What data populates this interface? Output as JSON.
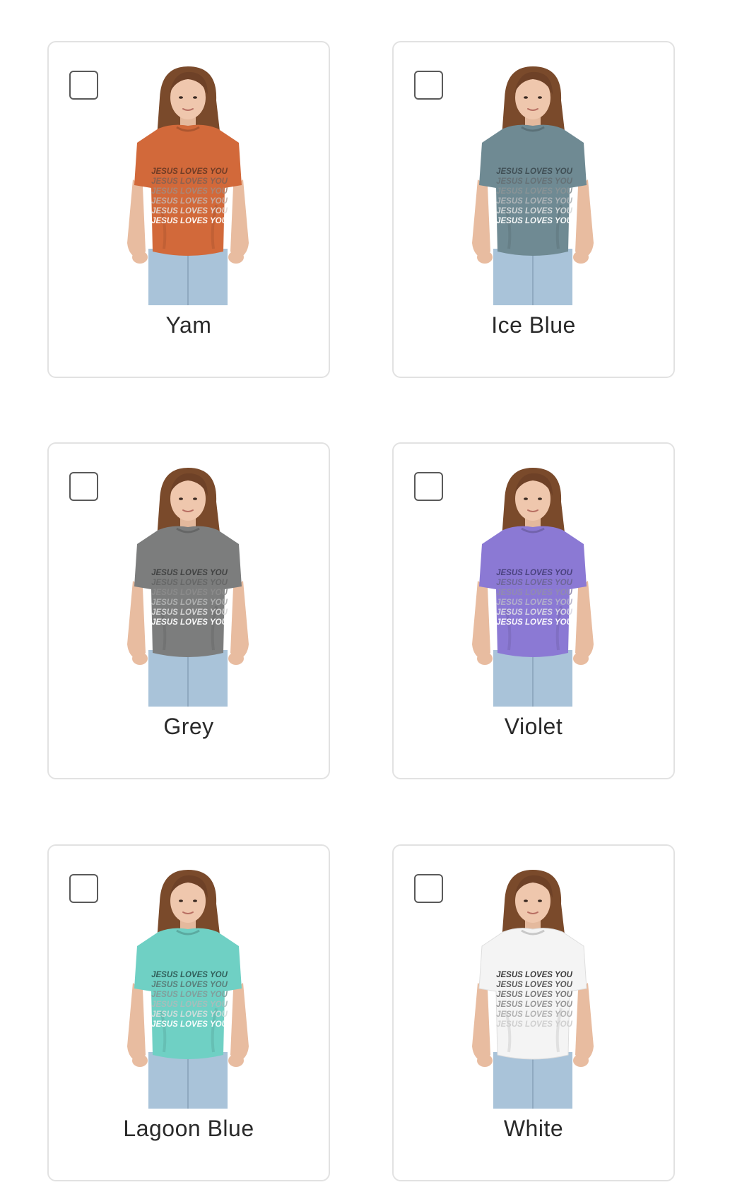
{
  "colors": [
    {
      "label": "Yam",
      "shirt": "#d2693a",
      "text_top": "#6b3a25",
      "text_bottom": "#ffffff",
      "icon": "tshirt-photo"
    },
    {
      "label": "Ice Blue",
      "shirt": "#6f8a93",
      "text_top": "#3e4c52",
      "text_bottom": "#ffffff",
      "icon": "tshirt-photo"
    },
    {
      "label": "Grey",
      "shirt": "#7c7d7d",
      "text_top": "#3f4040",
      "text_bottom": "#ffffff",
      "icon": "tshirt-photo"
    },
    {
      "label": "Violet",
      "shirt": "#8b79d4",
      "text_top": "#47407a",
      "text_bottom": "#ffffff",
      "icon": "tshirt-photo"
    },
    {
      "label": "Lagoon Blue",
      "shirt": "#6fd0c4",
      "text_top": "#2e5a55",
      "text_bottom": "#ffffff",
      "icon": "tshirt-photo"
    },
    {
      "label": "White",
      "shirt": "#f4f4f4",
      "text_top": "#333333",
      "text_bottom": "#cfcfcf",
      "icon": "tshirt-photo"
    }
  ],
  "shirt_print_text": "JESUS LOVES YOU",
  "checkbox_states": [
    false,
    false,
    false,
    false,
    false,
    false
  ]
}
